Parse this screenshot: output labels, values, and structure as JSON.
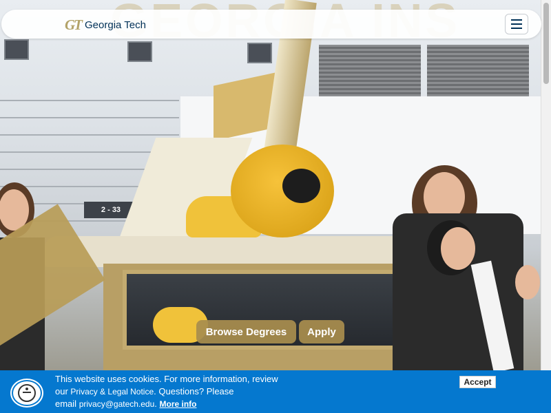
{
  "header": {
    "logo_mark": "GT",
    "logo_text": "Georgia Tech",
    "menu_icon": "hamburger-menu-icon"
  },
  "hero": {
    "background_text": "GEORGIA INS",
    "sign_number": "2 - 33",
    "buttons": {
      "browse_degrees": "Browse Degrees",
      "apply": "Apply"
    }
  },
  "cookie_banner": {
    "line1": "This website uses cookies. For more information, review",
    "line2_prefix": "our",
    "legal_link": "Privacy & Legal Notice",
    "line2_suffix": ". Questions? Please",
    "line3_prefix": "email",
    "email": "privacy@gatech.edu",
    "more_info": "More info",
    "accept": "Accept",
    "accessibility_icon": "accessibility-icon"
  },
  "colors": {
    "brand_gold": "#b3a369",
    "navy": "#003057",
    "banner_blue": "#0578cf"
  }
}
